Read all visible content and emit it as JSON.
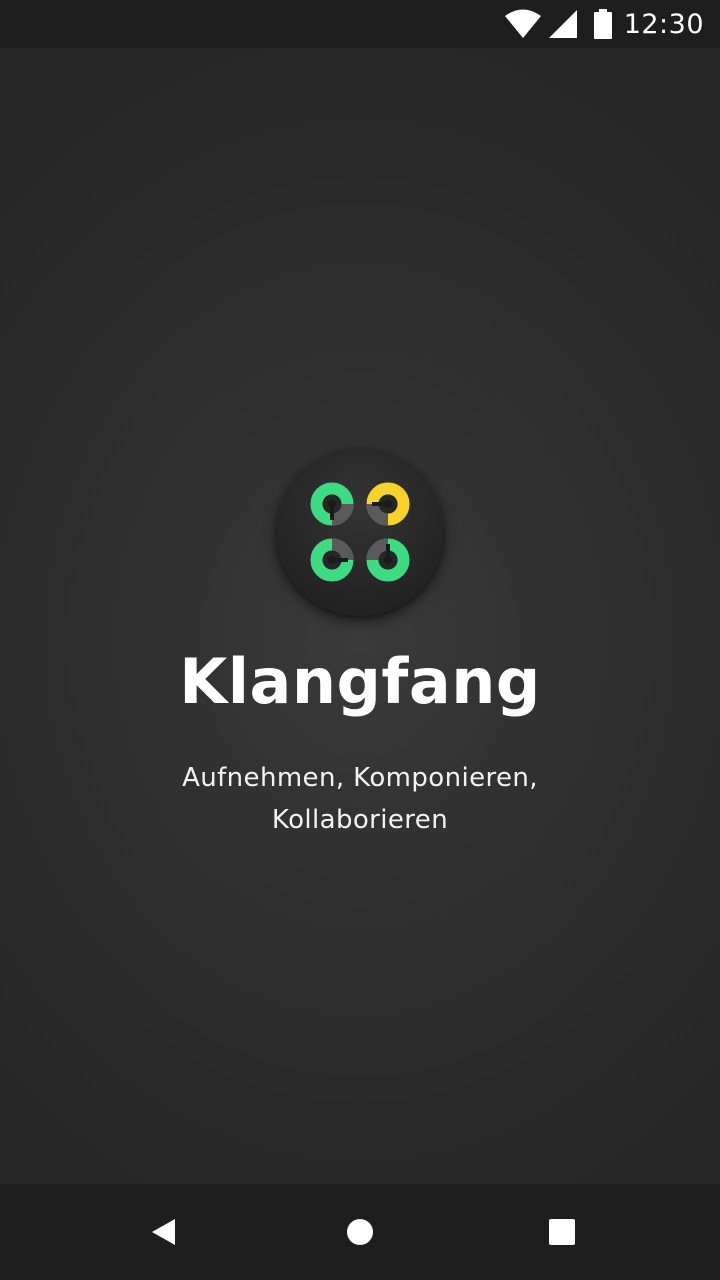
{
  "status_bar": {
    "time": "12:30",
    "icons": [
      "wifi-icon",
      "signal-icon",
      "battery-icon"
    ]
  },
  "app": {
    "name": "Klangfang",
    "tagline_line1": "Aufnehmen, Komponieren,",
    "tagline_line2": "Kollaborieren"
  },
  "logo": {
    "icon": "klangfang-logo-icon",
    "colors": {
      "green": "#3ddc84",
      "yellow": "#f5d327",
      "grey": "#5a5a5a",
      "background": "#262626"
    }
  },
  "nav_bar": {
    "buttons": [
      "back-icon",
      "home-icon",
      "recents-icon"
    ]
  },
  "colors": {
    "background": "#2f2f2f",
    "bars": "#1e1e1e",
    "text": "#ffffff"
  }
}
